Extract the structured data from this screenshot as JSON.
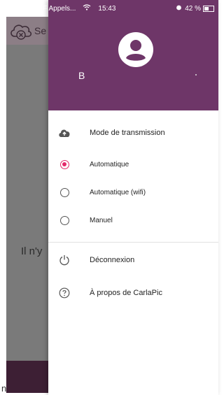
{
  "status_bar": {
    "carrier": "Orange F Appels...",
    "time": "15:43",
    "battery": "42 %"
  },
  "app": {
    "header_title_partial": "Se",
    "empty_text_partial": "Il n'y",
    "footer_partial": "n"
  },
  "drawer": {
    "username": "B",
    "transmission_label": "Mode de transmission",
    "options": [
      {
        "label": "Automatique",
        "selected": true
      },
      {
        "label": "Automatique (wifi)",
        "selected": false
      },
      {
        "label": "Manuel",
        "selected": false
      }
    ],
    "logout_label": "Déconnexion",
    "about_label": "À propos de CarlaPic"
  },
  "colors": {
    "drawer_header": "#6e3668",
    "radio_accent": "#e3286a",
    "dim_overlay": "#7a7a7a"
  }
}
